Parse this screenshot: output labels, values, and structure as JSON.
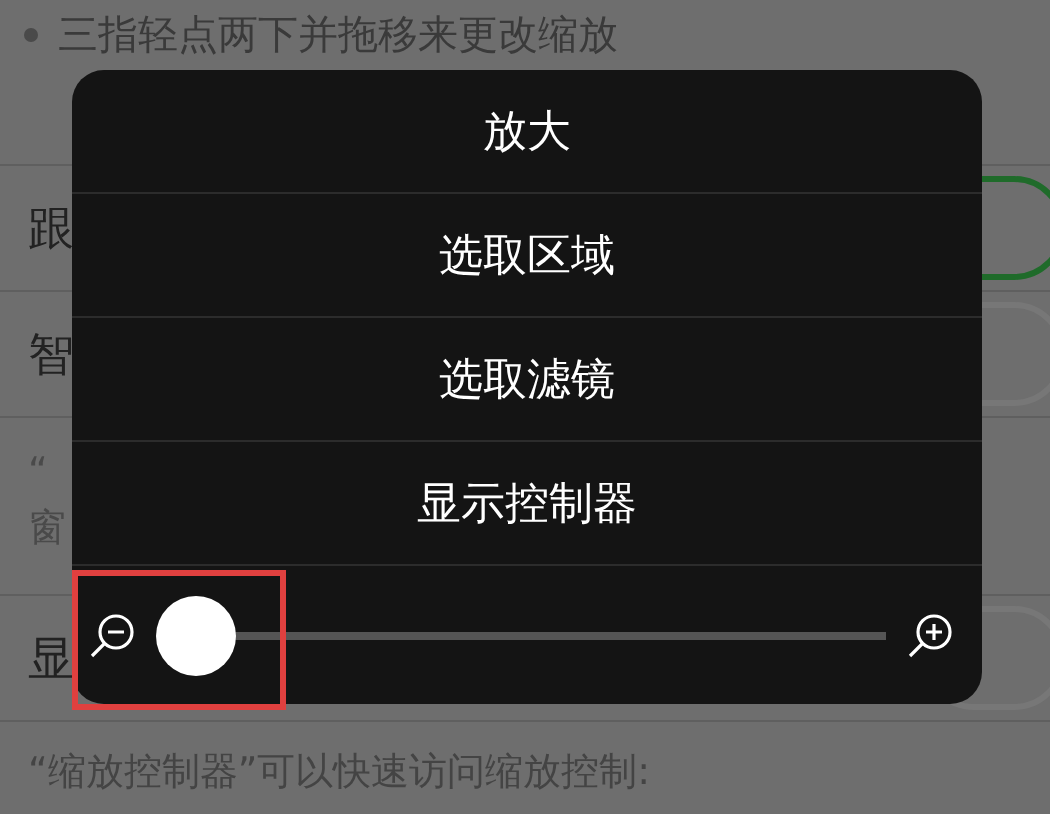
{
  "background": {
    "bullets": [
      "三指轻点两下并拖移来更改缩放"
    ],
    "rows": [
      {
        "label": "跟",
        "on": true
      },
      {
        "label": "智",
        "on": false
      }
    ],
    "note_lines": [
      "“",
      "窗"
    ],
    "row2": {
      "label": "显",
      "on": false
    },
    "footer": "“缩放控制器”可以快速访问缩放控制:"
  },
  "menu": {
    "items": [
      "放大",
      "选取区域",
      "选取滤镜",
      "显示控制器"
    ],
    "zoom_slider": {
      "level": 0.05
    }
  }
}
